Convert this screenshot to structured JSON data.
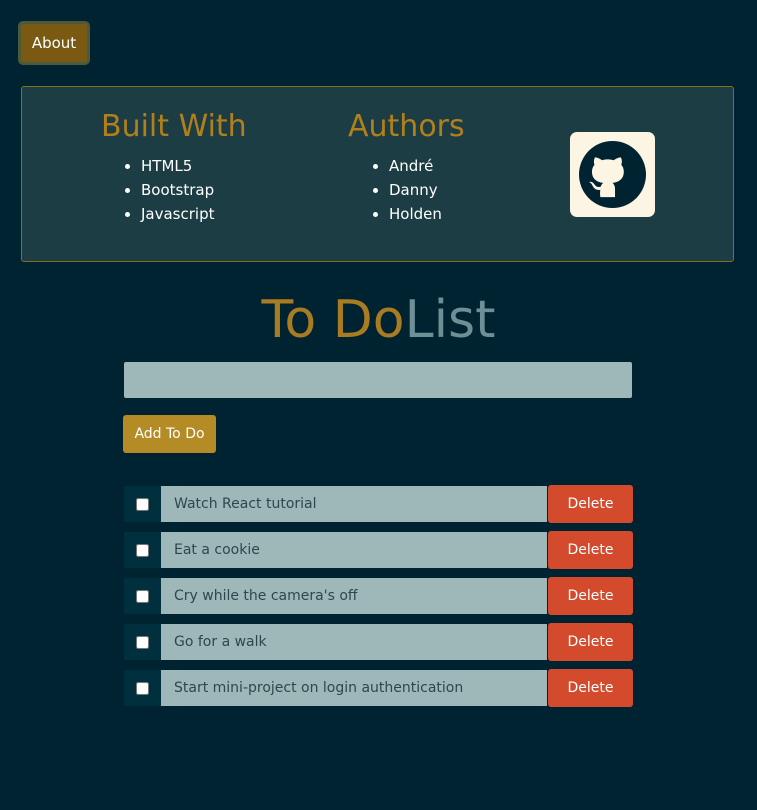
{
  "nav": {
    "about_label": "About"
  },
  "info": {
    "built_with": {
      "title": "Built With",
      "items": [
        "HTML5",
        "Bootstrap",
        "Javascript"
      ]
    },
    "authors": {
      "title": "Authors",
      "items": [
        "André",
        "Danny",
        "Holden"
      ]
    },
    "github_icon": "github-icon"
  },
  "main": {
    "title_part1": "To Do",
    "title_part2": "List",
    "input_value": "",
    "input_placeholder": "",
    "add_label": "Add To Do",
    "delete_label": "Delete",
    "todos": [
      {
        "text": "Watch React tutorial",
        "checked": false
      },
      {
        "text": "Eat a cookie",
        "checked": false
      },
      {
        "text": "Cry while the camera's off",
        "checked": false
      },
      {
        "text": "Go for a walk",
        "checked": false
      },
      {
        "text": "Start mini-project on login authentication",
        "checked": false
      }
    ]
  },
  "colors": {
    "background": "#002331",
    "accent": "#b58b25",
    "panel": "#1d3d45",
    "delete": "#d44a2c",
    "input": "#9eb7b9"
  }
}
